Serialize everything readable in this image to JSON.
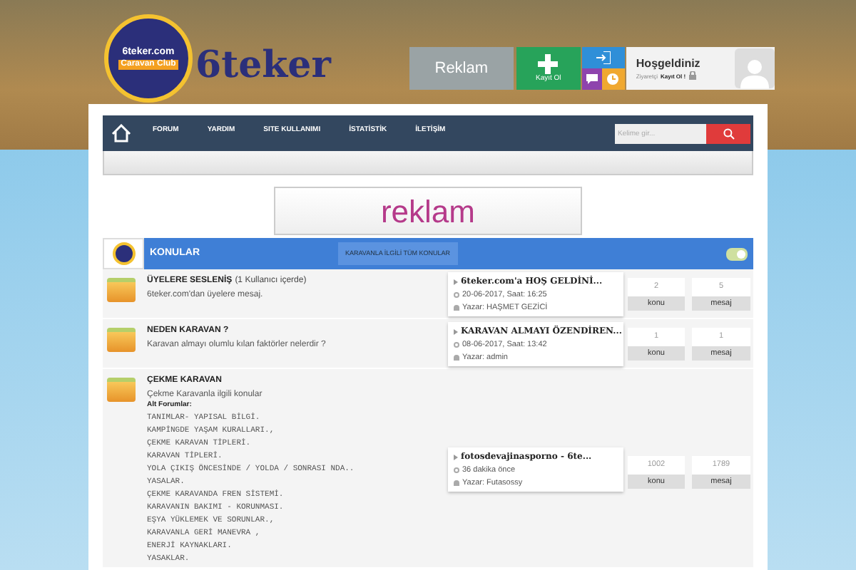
{
  "header": {
    "logo_text": "6teker.com",
    "logo_band": "Caravan Club",
    "brand": "6teker",
    "ad_tile": "Reklam",
    "register": "Kayıt Ol",
    "welcome": "Hoşgeldiniz",
    "visitor_label": "Ziyaretçi",
    "visitor_link": "Kayıt Ol !"
  },
  "nav": {
    "items": [
      {
        "label": "FORUM"
      },
      {
        "label": "YARDIM"
      },
      {
        "label": "SITE KULLANIMI"
      },
      {
        "label": "İSTATİSTİK"
      },
      {
        "label": "İLETİŞİM"
      }
    ],
    "search_placeholder": "Kelime gir..."
  },
  "banner": "reklam",
  "section": {
    "title": "KONULAR",
    "button": "KARAVANLA İLGİLİ TÜM KONULAR"
  },
  "forums": [
    {
      "title": "ÜYELERE SESLENİŞ",
      "viewers": "(1 Kullanıcı içerde)",
      "description": "6teker.com'dan üyelere mesaj.",
      "last_post": {
        "title": "6teker.com'a HOŞ GELDİNİ...",
        "date": "20-06-2017, Saat: 16:25",
        "author": "Yazar: HAŞMET GEZİCİ"
      },
      "topics": "2",
      "topics_label": "konu",
      "posts": "5",
      "posts_label": "mesaj"
    },
    {
      "title": "NEDEN KARAVAN ?",
      "description": "Karavan almayı olumlu kılan faktörler nelerdir ?",
      "last_post": {
        "title": "KARAVAN ALMAYI ÖZENDİREN...",
        "date": "08-06-2017, Saat: 13:42",
        "author": "Yazar: admin"
      },
      "topics": "1",
      "topics_label": "konu",
      "posts": "1",
      "posts_label": "mesaj"
    },
    {
      "title": "ÇEKME KARAVAN",
      "description": "Çekme Karavanla ilgili konular",
      "subforums_label": "Alt Forumlar:",
      "subforums": [
        "TANIMLAR- YAPISAL BİLGİ.",
        "KAMPİNGDE YAŞAM KURALLARI.,",
        "ÇEKME KARAVAN TİPLERİ.",
        "KARAVAN TİPLERİ.",
        "YOLA ÇIKIŞ ÖNCESİNDE / YOLDA / SONRASI NDA..",
        "YASALAR.",
        "ÇEKME KARAVANDA FREN SİSTEMİ.",
        "KARAVANIN BAKIMI - KORUNMASI.",
        "EŞYA YÜKLEMEK VE SORUNLAR.,",
        "KARAVANLA GERİ MANEVRA ,",
        "ENERJİ KAYNAKLARI.",
        "YASAKLAR."
      ],
      "last_post": {
        "title": "fotosdevajinasporno - 6te...",
        "date": "36 dakika önce",
        "author": "Yazar: Futasossy"
      },
      "topics": "1002",
      "topics_label": "konu",
      "posts": "1789",
      "posts_label": "mesaj"
    }
  ]
}
